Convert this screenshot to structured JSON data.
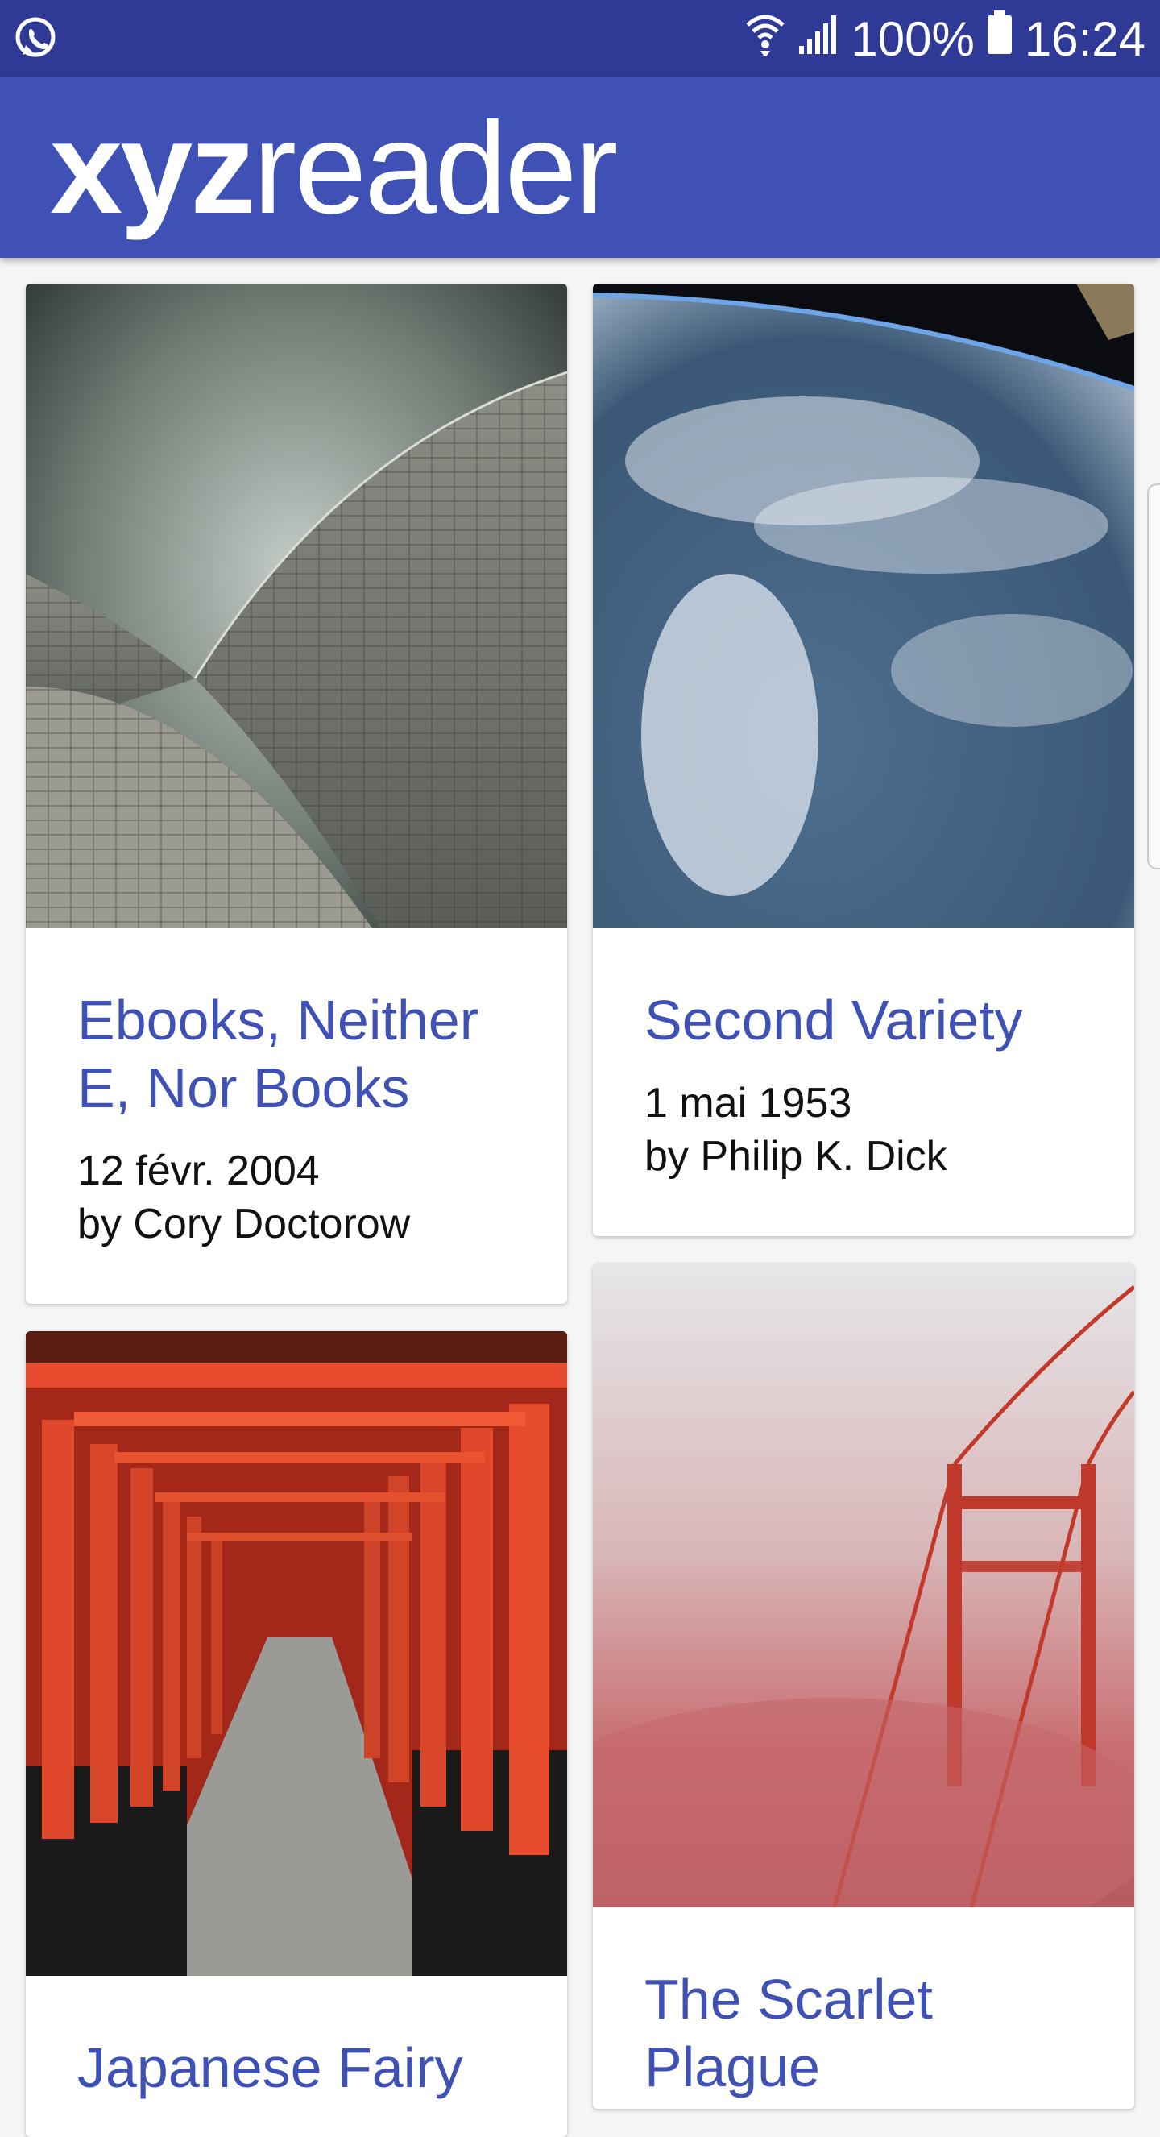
{
  "status_bar": {
    "left_icon": "whatsapp-icon",
    "wifi_icon": "wifi-icon",
    "signal_icon": "signal-icon",
    "battery_percent": "100%",
    "battery_icon": "battery-icon",
    "time": "16:24",
    "background_color": "#2f3a97"
  },
  "app_bar": {
    "logo_bold": "xyz",
    "logo_light": "reader",
    "background_color": "#3f51b5"
  },
  "articles": [
    {
      "title": "Ebooks, Neither E, Nor Books",
      "date": "12 févr. 2004",
      "author": "by Cory Doctorow",
      "image": "opera-house-shells-photo"
    },
    {
      "title": "Second Variety",
      "date": "1 mai 1953",
      "author": "by Philip K. Dick",
      "image": "earth-from-orbit-photo"
    },
    {
      "title": "Japanese Fairy",
      "image": "torii-gates-photo"
    },
    {
      "title": "The Scarlet Plague",
      "image": "bridge-in-fog-photo"
    }
  ],
  "accent_color": "#3f51b5"
}
